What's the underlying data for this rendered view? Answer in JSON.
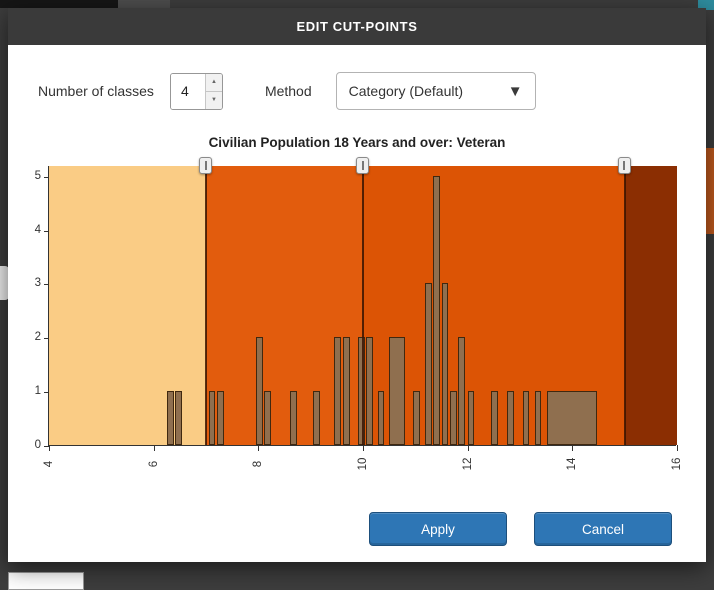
{
  "dialog": {
    "title": "EDIT CUT-POINTS",
    "header_bg": "#3A3A3A",
    "controls": {
      "classes_label": "Number of classes",
      "classes_value": "4",
      "method_label": "Method",
      "method_value": "Category (Default)"
    },
    "icons": {
      "dropdown_caret": "▼",
      "spinner_up": "▲",
      "spinner_down": "▼"
    },
    "buttons": {
      "apply_label": "Apply",
      "cancel_label": "Cancel",
      "color": "#2E76B5"
    }
  },
  "chart_data": {
    "type": "bar",
    "title": "Civilian Population 18 Years and over: Veteran",
    "xlabel": "",
    "ylabel": "",
    "xlim": [
      4,
      16
    ],
    "ylim": [
      0,
      5.2
    ],
    "x_ticks": [
      4,
      6,
      8,
      10,
      12,
      14,
      16
    ],
    "y_ticks": [
      0,
      1,
      2,
      3,
      4,
      5
    ],
    "cutpoints": [
      7,
      10,
      15
    ],
    "bands": [
      {
        "from": 4,
        "to": 7,
        "color": "#FACC85"
      },
      {
        "from": 7,
        "to": 10,
        "color": "#E25C0D"
      },
      {
        "from": 10,
        "to": 15,
        "color": "#DC5405"
      },
      {
        "from": 15,
        "to": 16,
        "color": "#8B2E02"
      }
    ],
    "bar_color": "#8F6F4F",
    "bar_border": "#40280F",
    "default_bar_width": 0.13,
    "bars": [
      {
        "x": 6.25,
        "h": 1
      },
      {
        "x": 6.41,
        "h": 1
      },
      {
        "x": 7.05,
        "h": 1
      },
      {
        "x": 7.21,
        "h": 1
      },
      {
        "x": 7.95,
        "h": 2
      },
      {
        "x": 8.11,
        "h": 1
      },
      {
        "x": 8.6,
        "h": 1
      },
      {
        "x": 9.05,
        "h": 1
      },
      {
        "x": 9.45,
        "h": 2
      },
      {
        "x": 9.62,
        "h": 2
      },
      {
        "x": 9.9,
        "h": 2
      },
      {
        "x": 10.06,
        "h": 2
      },
      {
        "x": 10.28,
        "h": 1
      },
      {
        "x": 10.5,
        "w": 0.3,
        "h": 2
      },
      {
        "x": 10.95,
        "h": 1
      },
      {
        "x": 11.18,
        "h": 3
      },
      {
        "x": 11.34,
        "h": 5
      },
      {
        "x": 11.5,
        "h": 3
      },
      {
        "x": 11.66,
        "h": 1
      },
      {
        "x": 11.82,
        "h": 2
      },
      {
        "x": 12.0,
        "h": 1
      },
      {
        "x": 12.45,
        "h": 1
      },
      {
        "x": 12.75,
        "h": 1
      },
      {
        "x": 13.05,
        "h": 1
      },
      {
        "x": 13.28,
        "h": 1
      },
      {
        "x": 13.52,
        "w": 0.95,
        "h": 1
      }
    ]
  }
}
